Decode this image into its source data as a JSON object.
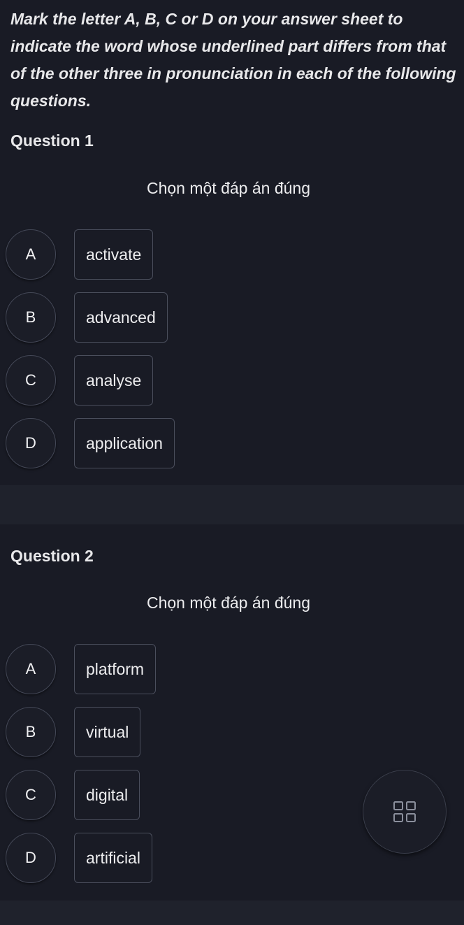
{
  "instructions": "Mark the letter A, B, C or D on your answer sheet to indicate the word whose underlined part differs from that of the other three in pronunciation in each of the following questions.",
  "questions": [
    {
      "title": "Question 1",
      "prompt": "Chọn một đáp án đúng",
      "options": [
        {
          "letter": "A",
          "text": "activate"
        },
        {
          "letter": "B",
          "text": "advanced"
        },
        {
          "letter": "C",
          "text": "analyse"
        },
        {
          "letter": "D",
          "text": "application"
        }
      ]
    },
    {
      "title": "Question 2",
      "prompt": "Chọn một đáp án đúng",
      "options": [
        {
          "letter": "A",
          "text": "platform"
        },
        {
          "letter": "B",
          "text": "virtual"
        },
        {
          "letter": "C",
          "text": "digital"
        },
        {
          "letter": "D",
          "text": "artificial"
        }
      ]
    }
  ],
  "fab": {
    "icon": "grid-icon"
  }
}
